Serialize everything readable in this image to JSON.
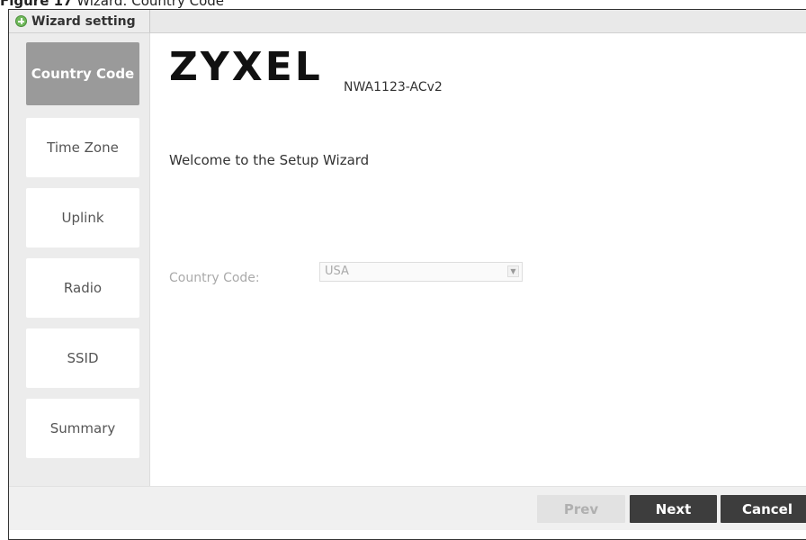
{
  "figure_caption": {
    "label": "Figure 17",
    "text": "Wizard: Country Code"
  },
  "window": {
    "title": "Wizard setting"
  },
  "sidebar": {
    "steps": [
      {
        "label": "Country Code",
        "active": true
      },
      {
        "label": "Time Zone",
        "active": false
      },
      {
        "label": "Uplink",
        "active": false
      },
      {
        "label": "Radio",
        "active": false
      },
      {
        "label": "SSID",
        "active": false
      },
      {
        "label": "Summary",
        "active": false
      }
    ]
  },
  "main": {
    "brand": "ZYXEL",
    "model": "NWA1123-ACv2",
    "welcome": "Welcome to the Setup Wizard",
    "country_code_label": "Country Code:",
    "country_code_value": "USA"
  },
  "footer": {
    "prev_label": "Prev",
    "next_label": "Next",
    "cancel_label": "Cancel"
  },
  "colors": {
    "active_step": "#9a9a9a",
    "primary_button": "#3d3d3d",
    "disabled_button": "#e2e2e2",
    "status_icon": "#6fb85a"
  }
}
